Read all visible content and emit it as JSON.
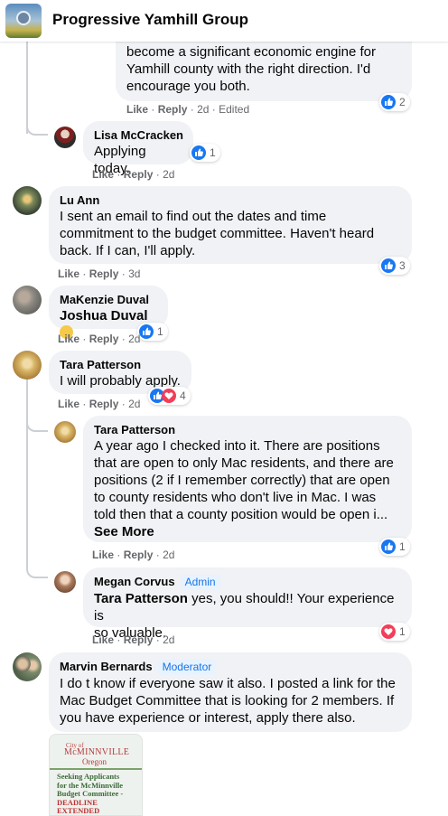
{
  "header": {
    "group_name": "Progressive Yamhill Group",
    "avatar_icon": "group-avatar-image"
  },
  "colors": {
    "link": "#1b74e4",
    "like": "#1877f2",
    "love": "#f33e58",
    "bubble": "#f0f2f5",
    "meta": "#65676b"
  },
  "actions": {
    "like": "Like",
    "reply": "Reply",
    "sep": "·"
  },
  "comments": [
    {
      "author": "",
      "lines": [
        "become a significant economic engine for",
        "Yamhill county with the right direction. I'd",
        "encourage you both."
      ],
      "time": "2d",
      "edited": "Edited",
      "reactions": {
        "types": [
          "like"
        ],
        "count": "2"
      }
    },
    {
      "author": "Lisa McCracken",
      "lines": [
        "Applying today."
      ],
      "time": "2d",
      "reactions": {
        "types": [
          "like"
        ],
        "count": "1"
      }
    },
    {
      "author": "Lu Ann",
      "lines": [
        "I sent an email to find out the dates and time",
        "commitment to the budget committee. Haven't heard",
        "back. If I can, I'll apply."
      ],
      "time": "3d",
      "reactions": {
        "types": [
          "like"
        ],
        "count": "3"
      }
    },
    {
      "author": "MaKenzie Duval",
      "mention": "Joshua Duval",
      "emoji": "thinking-face-icon",
      "time": "2d",
      "reactions": {
        "types": [
          "like"
        ],
        "count": "1"
      }
    },
    {
      "author": "Tara Patterson",
      "lines": [
        "I will probably apply."
      ],
      "time": "2d",
      "reactions": {
        "types": [
          "like",
          "love"
        ],
        "count": "4"
      }
    },
    {
      "author": "Tara Patterson",
      "lines": [
        "A year ago I checked into it. There are positions",
        "that are open to only Mac residents, and there are",
        "positions (2 if I remember correctly) that are open",
        "to county residents who don't live in Mac. I was",
        "told then that a county position would be open i..."
      ],
      "see_more": "See More",
      "time": "2d",
      "reactions": {
        "types": [
          "like"
        ],
        "count": "1"
      }
    },
    {
      "author": "Megan Corvus",
      "role": "Admin",
      "mention": "Tara Patterson",
      "lines": [
        " yes, you should!! Your experience is",
        "so valuable."
      ],
      "time": "2d",
      "reactions": {
        "types": [
          "love"
        ],
        "count": "1"
      }
    },
    {
      "author": "Marvin Bernards",
      "role": "Moderator",
      "lines": [
        "I do t know if everyone saw it also. I posted a link for the",
        "Mac Budget Committee that is looking for 2 members. If",
        "you have experience or interest, apply there also."
      ]
    }
  ],
  "attachment": {
    "city_prefix": "City of",
    "city": "McMINNVILLE",
    "state": "Oregon",
    "lines": [
      "Seeking Applicants",
      "for the McMinnville",
      "Budget Committee -"
    ],
    "deadline": [
      "DEADLINE",
      "EXTENDED"
    ]
  }
}
